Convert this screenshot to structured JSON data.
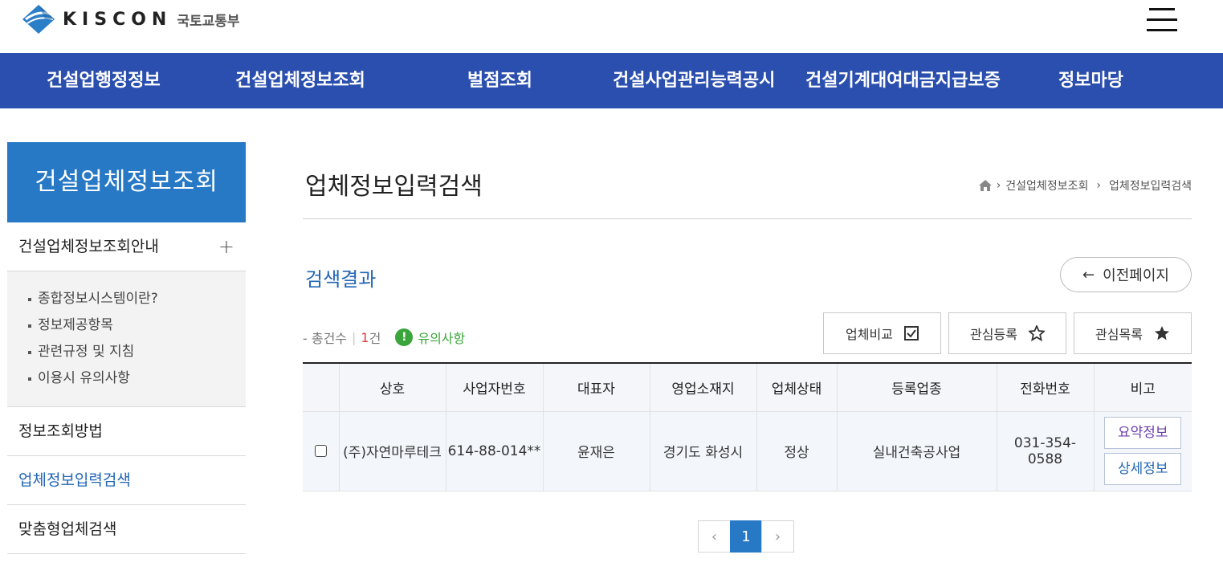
{
  "header": {
    "logo_text": "KISCON",
    "logo_sub": "국토교통부"
  },
  "gnb": [
    {
      "label": "건설업행정정보"
    },
    {
      "label": "건설업체정보조회"
    },
    {
      "label": "벌점조회"
    },
    {
      "label": "건설사업관리능력공시"
    },
    {
      "label": "건설기계대여대금지급보증"
    },
    {
      "label": "정보마당"
    }
  ],
  "sidebar": {
    "title": "건설업체정보조회",
    "menu_guide": "건설업체정보조회안내",
    "plus": "+",
    "sub_items": [
      {
        "label": "종합정보시스템이란?"
      },
      {
        "label": "정보제공항목"
      },
      {
        "label": "관련규정 및 지침"
      },
      {
        "label": "이용시 유의사항"
      }
    ],
    "items": [
      {
        "label": "정보조회방법"
      },
      {
        "label": "업체정보입력검색"
      },
      {
        "label": "맞춤형업체검색"
      }
    ]
  },
  "main": {
    "title": "업체정보입력검색",
    "breadcrumb": [
      "건설업체정보조회",
      "업체정보입력검색"
    ],
    "section_title": "검색결과",
    "prev_button": "이전페이지",
    "prev_arrow": "←",
    "count_label": "- 총건수",
    "count_value": "1",
    "count_unit": "건",
    "notice_icon": "!",
    "notice_label": "유의사항",
    "tools": [
      {
        "label": "업체비교",
        "icon": "checkbox-icon"
      },
      {
        "label": "관심등록",
        "icon": "star-outline-icon"
      },
      {
        "label": "관심목록",
        "icon": "star-filled-icon"
      }
    ]
  },
  "table": {
    "headers": [
      "",
      "상호",
      "사업자번호",
      "대표자",
      "영업소재지",
      "업체상태",
      "등록업종",
      "전화번호",
      "비고"
    ],
    "rows": [
      {
        "name": "(주)자연마루테크",
        "biz_no": "614-88-014**",
        "ceo": "윤재은",
        "location": "경기도 화성시",
        "status": "정상",
        "category": "실내건축공사업",
        "phone": "031-354-0588",
        "btn_summary": "요약정보",
        "btn_detail": "상세정보"
      }
    ]
  },
  "pagination": {
    "prev": "‹",
    "current": "1",
    "next": "›"
  }
}
